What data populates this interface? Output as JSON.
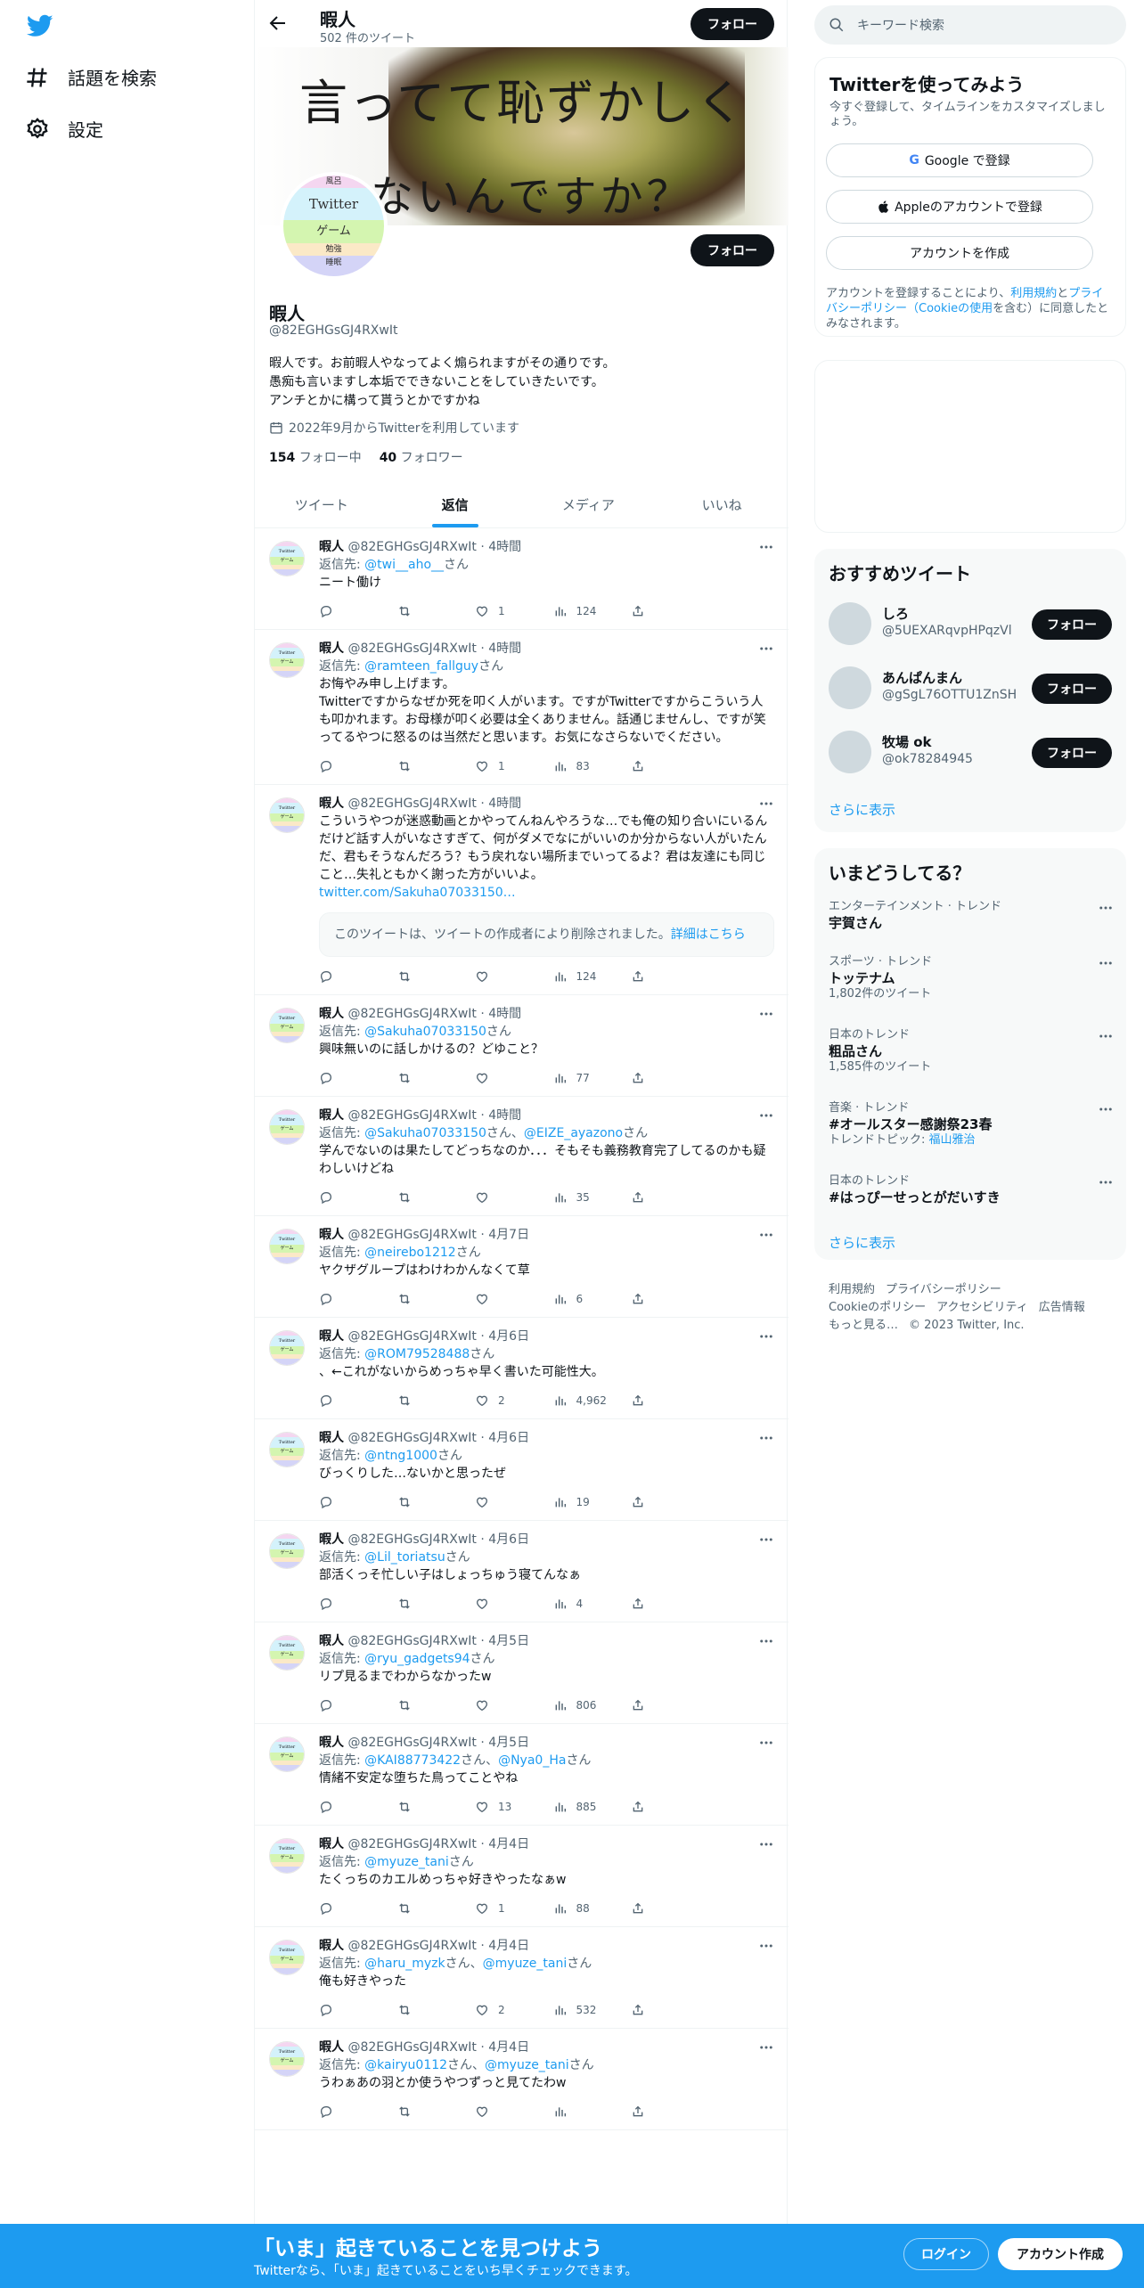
{
  "nav": {
    "explore_label": "話題を検索",
    "settings_label": "設定"
  },
  "header": {
    "name": "暇人",
    "tweet_count": "502 件のツイート",
    "follow_label": "フォロー"
  },
  "banner": {
    "line1": "言ってて恥ずかしく",
    "line2": "ないんですか？"
  },
  "avatar_bands": [
    "風呂",
    "Twitter",
    "ゲーム",
    "勉強",
    "睡眠"
  ],
  "profile": {
    "name": "暇人",
    "handle": "@82EGHGsGJ4RXwIt",
    "bio": "暇人です。お前暇人やなってよく煽られますがその通りです。\n愚痴も言いますし本垢でできないことをしていきたいです。\nアンチとかに構って貰うとかですかね",
    "joined": "2022年9月からTwitterを利用しています",
    "following_count": "154",
    "following_label": "フォロー中",
    "followers_count": "40",
    "followers_label": "フォロワー",
    "follow_label": "フォロー"
  },
  "tabs": [
    {
      "label": "ツイート",
      "active": false
    },
    {
      "label": "返信",
      "active": true
    },
    {
      "label": "メディア",
      "active": false
    },
    {
      "label": "いいね",
      "active": false
    }
  ],
  "tweets": [
    {
      "name": "暇人",
      "meta": "@82EGHGsGJ4RXwIt · 4時間",
      "reply_prefix": "返信先: ",
      "reply_to": "@twi__aho__",
      "reply_suffix": "さん",
      "text": "ニート働け",
      "likes": "1",
      "views": "124"
    },
    {
      "name": "暇人",
      "meta": "@82EGHGsGJ4RXwIt · 4時間",
      "reply_prefix": "返信先: ",
      "reply_to": "@ramteen_fallguy",
      "reply_suffix": "さん",
      "text": "お悔やみ申し上げます。\nTwitterですからなぜか死を叩く人がいます。ですがTwitterですからこういう人も叩かれます。お母様が叩く必要は全くありません。話通じませんし、ですが笑ってるやつに怒るのは当然だと思います。お気になさらないでください。",
      "likes": "1",
      "views": "83"
    },
    {
      "name": "暇人",
      "meta": "@82EGHGsGJ4RXwIt · 4時間",
      "reply_prefix": "",
      "reply_to": "",
      "reply_suffix": "",
      "text": "こういうやつが迷惑動画とかやってんねんやろうな…でも俺の知り合いにいるんだけど話す人がいなさすぎて、何がダメでなにがいいのか分からない人がいたんだ、君もそうなんだろう？もう戻れない場所までいってるよ？君は友達にも同じこと…失礼ともかく謝った方がいいよ。",
      "link": "twitter.com/Sakuha07033150…",
      "quote": "このツイートは、ツイートの作成者により削除されました。",
      "quote_link": "詳細はこちら",
      "likes": "",
      "views": "124"
    },
    {
      "name": "暇人",
      "meta": "@82EGHGsGJ4RXwIt · 4時間",
      "reply_prefix": "返信先: ",
      "reply_to": "@Sakuha07033150",
      "reply_suffix": "さん",
      "text": "興味無いのに話しかけるの？どゆこと？",
      "likes": "",
      "views": "77"
    },
    {
      "name": "暇人",
      "meta": "@82EGHGsGJ4RXwIt · 4時間",
      "reply_prefix": "返信先: ",
      "reply_to": "@Sakuha07033150",
      "reply_suffix": "さん、",
      "reply_to2": "@EIZE_ayazono",
      "reply_suffix2": "さん",
      "text": "学んでないのは果たしてどっちなのか．．．そもそも義務教育完了してるのかも疑わしいけどね",
      "likes": "",
      "views": "35"
    },
    {
      "name": "暇人",
      "meta": "@82EGHGsGJ4RXwIt · 4月7日",
      "reply_prefix": "返信先: ",
      "reply_to": "@neirebo1212",
      "reply_suffix": "さん",
      "text": "ヤクザグループはわけわかんなくて草",
      "likes": "",
      "views": "6"
    },
    {
      "name": "暇人",
      "meta": "@82EGHGsGJ4RXwIt · 4月6日",
      "reply_prefix": "返信先: ",
      "reply_to": "@ROM79528488",
      "reply_suffix": "さん",
      "text": "、←これがないからめっちゃ早く書いた可能性大。",
      "likes": "2",
      "views": "4,962"
    },
    {
      "name": "暇人",
      "meta": "@82EGHGsGJ4RXwIt · 4月6日",
      "reply_prefix": "返信先: ",
      "reply_to": "@ntng1000",
      "reply_suffix": "さん",
      "text": "びっくりした…ないかと思ったぜ",
      "likes": "",
      "views": "19"
    },
    {
      "name": "暇人",
      "meta": "@82EGHGsGJ4RXwIt · 4月6日",
      "reply_prefix": "返信先: ",
      "reply_to": "@Lil_toriatsu",
      "reply_suffix": "さん",
      "text": "部活くっそ忙しい子はしょっちゅう寝てんなぁ",
      "likes": "",
      "views": "4"
    },
    {
      "name": "暇人",
      "meta": "@82EGHGsGJ4RXwIt · 4月5日",
      "reply_prefix": "返信先: ",
      "reply_to": "@ryu_gadgets94",
      "reply_suffix": "さん",
      "text": "リプ見るまでわからなかったw",
      "likes": "",
      "views": "806"
    },
    {
      "name": "暇人",
      "meta": "@82EGHGsGJ4RXwIt · 4月5日",
      "reply_prefix": "返信先: ",
      "reply_to": "@KAI88773422",
      "reply_suffix": "さん、",
      "reply_to2": "@Nya0_Ha",
      "reply_suffix2": "さん",
      "text": "情緒不安定な堕ちた鳥ってことやね",
      "likes": "13",
      "views": "885"
    },
    {
      "name": "暇人",
      "meta": "@82EGHGsGJ4RXwIt · 4月4日",
      "reply_prefix": "返信先: ",
      "reply_to": "@myuze_tani",
      "reply_suffix": "さん",
      "text": "たくっちのカエルめっちゃ好きやったなぁw",
      "likes": "1",
      "views": "88"
    },
    {
      "name": "暇人",
      "meta": "@82EGHGsGJ4RXwIt · 4月4日",
      "reply_prefix": "返信先: ",
      "reply_to": "@haru_myzk",
      "reply_suffix": "さん、",
      "reply_to2": "@myuze_tani",
      "reply_suffix2": "さん",
      "text": "俺も好きやった",
      "likes": "2",
      "views": "532"
    },
    {
      "name": "暇人",
      "meta": "@82EGHGsGJ4RXwIt · 4月4日",
      "reply_prefix": "返信先: ",
      "reply_to": "@kairyu0112",
      "reply_suffix": "さん、",
      "reply_to2": "@myuze_tani",
      "reply_suffix2": "さん",
      "text": "うわぁあの羽とか使うやつずっと見てたわw",
      "likes": "",
      "views": ""
    }
  ],
  "search": {
    "placeholder": "キーワード検索"
  },
  "signup_card": {
    "title": "Twitterを使ってみよう",
    "subtitle": "今すぐ登録して、タイムラインをカスタマイズしましょう。",
    "google": "Google で登録",
    "apple": "Appleのアカウントで登録",
    "create": "アカウントを作成",
    "legal_1": "アカウントを登録することにより、",
    "legal_terms": "利用規約",
    "legal_2": "と",
    "legal_privacy": "プライバシーポリシー（Cookieの使用",
    "legal_3": "を含む）に同意したとみなされます。"
  },
  "recommend": {
    "title": "おすすめツイート",
    "users": [
      {
        "name": "しろ",
        "handle": "@5UEXARqvpHPqzVl",
        "follow": "フォロー"
      },
      {
        "name": "あんぱんまん",
        "handle": "@gSgL76OTTU1ZnSH",
        "follow": "フォロー"
      },
      {
        "name": "牧場 ok",
        "handle": "@ok78284945",
        "follow": "フォロー"
      }
    ],
    "show_more": "さらに表示"
  },
  "trends": {
    "title": "いまどうしてる？",
    "items": [
      {
        "category": "エンターテインメント · トレンド",
        "name": "宇賀さん",
        "count": ""
      },
      {
        "category": "スポーツ · トレンド",
        "name": "トッテナム",
        "count": "1,802件のツイート"
      },
      {
        "category": "日本のトレンド",
        "name": "粗品さん",
        "count": "1,585件のツイート"
      },
      {
        "category": "音楽 · トレンド",
        "name": "#オールスター感謝祭23春",
        "count": "トレンドトピック: ",
        "count_link": "福山雅治"
      },
      {
        "category": "日本のトレンド",
        "name": "#はっぴーせっとがだいすき",
        "count": ""
      }
    ],
    "show_more": "さらに表示"
  },
  "footer": {
    "terms": "利用規約",
    "privacy": "プライバシーポリシー",
    "cookie": "Cookieのポリシー",
    "accessibility": "アクセシビリティ",
    "ads": "広告情報",
    "more": "もっと見る…",
    "copyright": "© 2023 Twitter, Inc."
  },
  "bottom": {
    "title": "「いま」起きていることを見つけよう",
    "subtitle": "Twitterなら、「いま」起きていることをいち早くチェックできます。",
    "login": "ログイン",
    "signup": "アカウント作成"
  },
  "colors": {
    "accent": "#1d9bf0",
    "text": "#0f1419",
    "muted": "#536471",
    "button": "#0f1419"
  }
}
